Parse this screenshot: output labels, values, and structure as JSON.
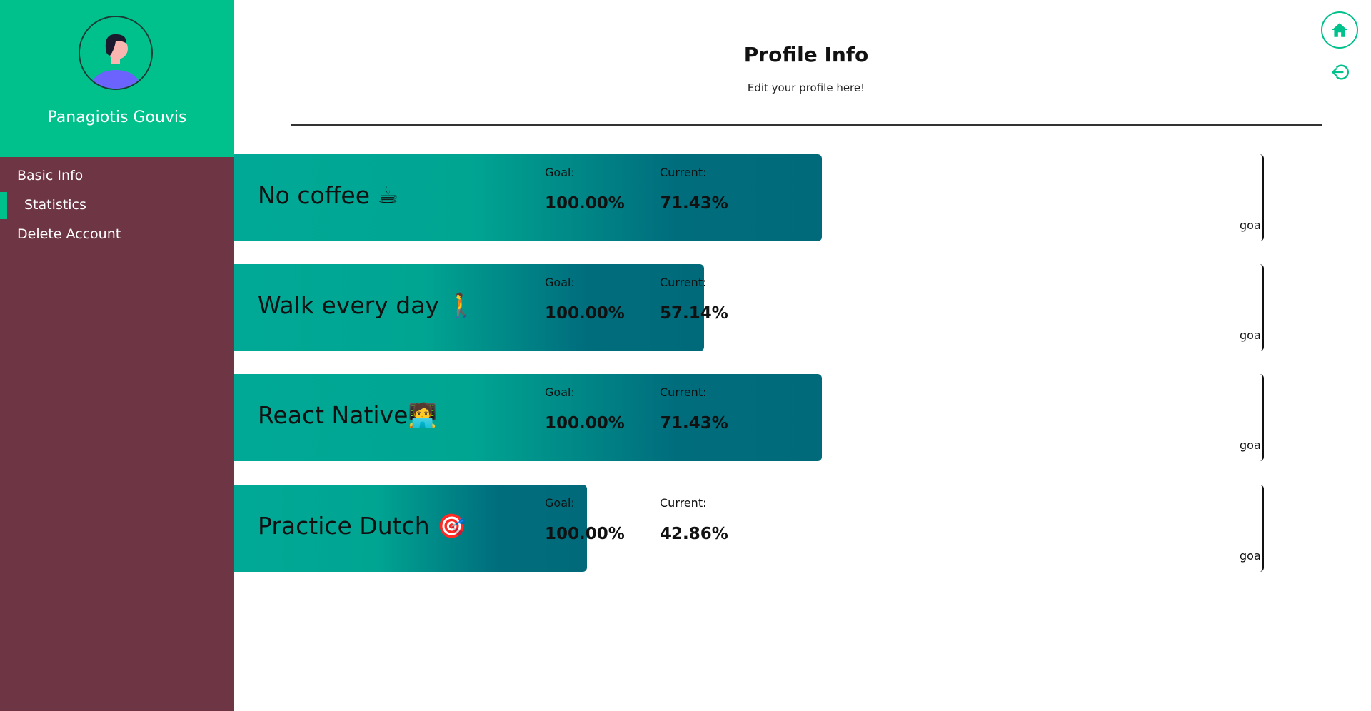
{
  "colors": {
    "sidebar_bg": "#6e3544",
    "accent": "#00c08b",
    "bar_gradient_start": "#00a996",
    "bar_gradient_end": "#006a7a"
  },
  "profile": {
    "name": "Panagiotis Gouvis"
  },
  "sidebar": {
    "items": [
      {
        "label": "Basic Info",
        "active": false
      },
      {
        "label": "Statistics",
        "active": true
      },
      {
        "label": "Delete Account",
        "active": false
      }
    ]
  },
  "header": {
    "title": "Profile Info",
    "subtitle": "Edit your profile here!"
  },
  "icons": {
    "home": "home-icon",
    "logout": "logout-icon"
  },
  "stats": {
    "goal_label": "Goal:",
    "current_label": "Current:",
    "marker_label": "goal",
    "habits": [
      {
        "name": "No coffee ☕",
        "goal": "100.00%",
        "current": "71.43%",
        "progress": 0.7143
      },
      {
        "name": "Walk every day 🚶",
        "goal": "100.00%",
        "current": "57.14%",
        "progress": 0.5714
      },
      {
        "name": "React Native🧑‍💻",
        "goal": "100.00%",
        "current": "71.43%",
        "progress": 0.7143
      },
      {
        "name": "Practice Dutch 🎯",
        "goal": "100.00%",
        "current": "42.86%",
        "progress": 0.4286
      }
    ]
  }
}
